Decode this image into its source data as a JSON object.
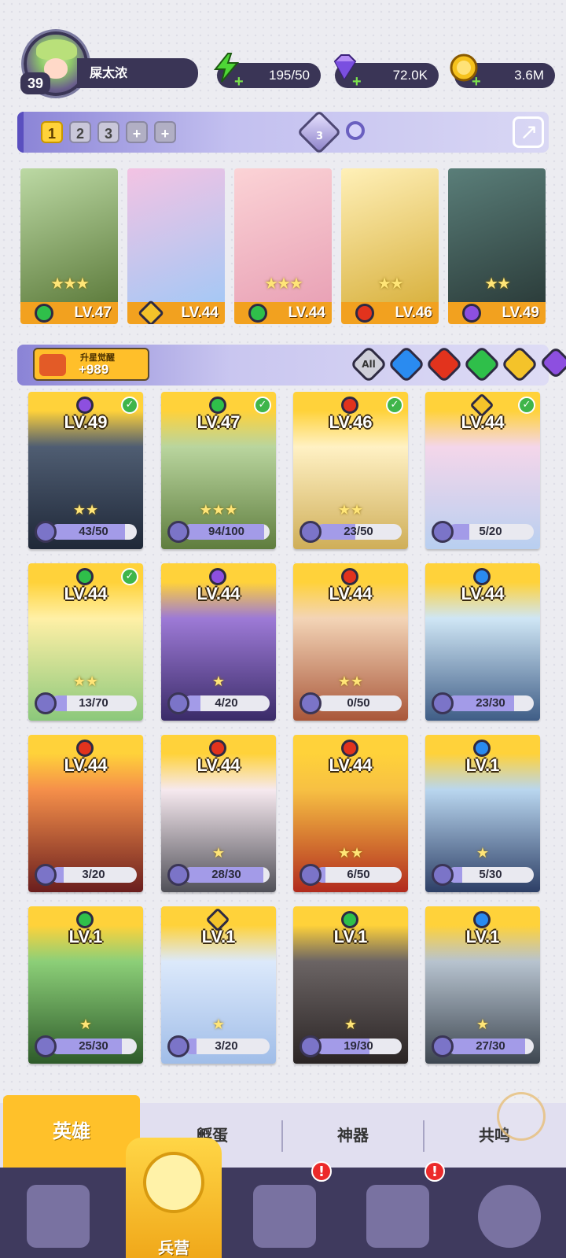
{
  "player": {
    "level": "39",
    "name": "屎太浓"
  },
  "resources": {
    "energy": "195/50",
    "gems": "72.0K",
    "gold": "3.6M"
  },
  "team": {
    "tabs": [
      "1",
      "2",
      "3"
    ],
    "crystal_count": "3",
    "cards": [
      {
        "level": "LV.47",
        "element": "nature",
        "stars": "★★★",
        "palette": [
          "#bcd9a4",
          "#5f7d3e"
        ]
      },
      {
        "level": "LV.44",
        "element": "light",
        "stars": "",
        "palette": [
          "#f3c3e3",
          "#a6c8f5"
        ]
      },
      {
        "level": "LV.44",
        "element": "nature",
        "stars": "★★★",
        "palette": [
          "#fbd3d6",
          "#e9a2b6"
        ]
      },
      {
        "level": "LV.46",
        "element": "fire",
        "stars": "★★",
        "palette": [
          "#fff0b8",
          "#d9b240"
        ]
      },
      {
        "level": "LV.49",
        "element": "dark",
        "stars": "★★",
        "palette": [
          "#5a7e79",
          "#2c3d3b"
        ]
      }
    ]
  },
  "filter": {
    "upgrade_label": "升星觉醒",
    "upgrade_count": "+989",
    "all_label": "All",
    "elements": [
      "water",
      "fire",
      "nature",
      "light",
      "dark"
    ]
  },
  "heroes": [
    {
      "level": "LV.49",
      "element": "dark",
      "check": true,
      "stars": "★★",
      "progress": "43/50",
      "fill": 0.86,
      "palette": [
        "#4f5d72",
        "#1f2838"
      ]
    },
    {
      "level": "LV.47",
      "element": "nature",
      "check": true,
      "stars": "★★★",
      "progress": "94/100",
      "fill": 0.94,
      "palette": [
        "#b9d59e",
        "#5f7d3e"
      ]
    },
    {
      "level": "LV.46",
      "element": "fire",
      "check": true,
      "stars": "★★",
      "progress": "23/50",
      "fill": 0.46,
      "palette": [
        "#fff1c4",
        "#cfae58"
      ]
    },
    {
      "level": "LV.44",
      "element": "light",
      "check": true,
      "stars": "",
      "progress": "5/20",
      "fill": 0.25,
      "palette": [
        "#f4d6ea",
        "#b8cff0"
      ]
    },
    {
      "level": "LV.44",
      "element": "nature",
      "check": true,
      "stars": "★★",
      "progress": "13/70",
      "fill": 0.19,
      "palette": [
        "#fff0a6",
        "#8bc87b"
      ]
    },
    {
      "level": "LV.44",
      "element": "dark",
      "check": false,
      "stars": "★",
      "progress": "4/20",
      "fill": 0.2,
      "palette": [
        "#9d7ad6",
        "#3a2b68"
      ]
    },
    {
      "level": "LV.44",
      "element": "fire",
      "check": false,
      "stars": "★★",
      "progress": "0/50",
      "fill": 0.0,
      "palette": [
        "#f3d4b6",
        "#a9573a"
      ]
    },
    {
      "level": "LV.44",
      "element": "water",
      "check": false,
      "stars": "",
      "progress": "23/30",
      "fill": 0.77,
      "palette": [
        "#cfe6f5",
        "#3f5d86"
      ]
    },
    {
      "level": "LV.44",
      "element": "fire",
      "check": false,
      "stars": "",
      "progress": "3/20",
      "fill": 0.15,
      "palette": [
        "#f58f4a",
        "#6a1e1e"
      ]
    },
    {
      "level": "LV.44",
      "element": "fire",
      "check": false,
      "stars": "★",
      "progress": "28/30",
      "fill": 0.93,
      "palette": [
        "#f6e9ef",
        "#505058"
      ]
    },
    {
      "level": "LV.44",
      "element": "fire",
      "check": false,
      "stars": "★★",
      "progress": "6/50",
      "fill": 0.12,
      "palette": [
        "#f7c043",
        "#b12a1e"
      ]
    },
    {
      "level": "LV.1",
      "element": "water",
      "check": false,
      "stars": "★",
      "progress": "5/30",
      "fill": 0.17,
      "palette": [
        "#b9d6ef",
        "#2d3f66"
      ]
    },
    {
      "level": "LV.1",
      "element": "nature",
      "check": false,
      "stars": "★",
      "progress": "25/30",
      "fill": 0.83,
      "palette": [
        "#8ccf78",
        "#2e5b2a"
      ]
    },
    {
      "level": "LV.1",
      "element": "light",
      "check": false,
      "stars": "★",
      "progress": "3/20",
      "fill": 0.15,
      "palette": [
        "#dce9fb",
        "#a0bde8"
      ]
    },
    {
      "level": "LV.1",
      "element": "nature",
      "check": false,
      "stars": "★",
      "progress": "19/30",
      "fill": 0.63,
      "palette": [
        "#6b6464",
        "#2a2424"
      ]
    },
    {
      "level": "LV.1",
      "element": "water",
      "check": false,
      "stars": "★",
      "progress": "27/30",
      "fill": 0.9,
      "palette": [
        "#b7c3cf",
        "#3d4650"
      ]
    }
  ],
  "subtabs": [
    "英雄",
    "孵蛋",
    "神器",
    "共鸣"
  ],
  "nav": {
    "active_label": "兵营",
    "badge": "!"
  },
  "colors": {
    "accent_yellow": "#ffc12a",
    "panel_purple": "#8a83d6",
    "nav_dark": "#3f3a5e"
  }
}
